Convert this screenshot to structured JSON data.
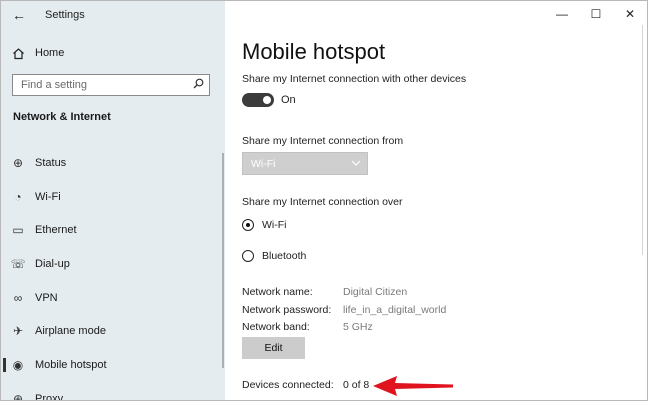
{
  "window": {
    "app_title": "Settings",
    "controls": {
      "minimize": "—",
      "maximize": "☐",
      "close": "✕"
    }
  },
  "sidebar": {
    "back_glyph": "←",
    "home_label": "Home",
    "search_placeholder": "Find a setting",
    "section_header": "Network & Internet",
    "items": [
      {
        "label": "Status",
        "icon": "status-icon",
        "glyph": "⊕"
      },
      {
        "label": "Wi-Fi",
        "icon": "wifi-icon",
        "glyph": "◔"
      },
      {
        "label": "Ethernet",
        "icon": "ethernet-icon",
        "glyph": "▭"
      },
      {
        "label": "Dial-up",
        "icon": "dialup-icon",
        "glyph": "☏"
      },
      {
        "label": "VPN",
        "icon": "vpn-icon",
        "glyph": "∞"
      },
      {
        "label": "Airplane mode",
        "icon": "airplane-icon",
        "glyph": "✈"
      },
      {
        "label": "Mobile hotspot",
        "icon": "hotspot-icon",
        "glyph": "◉",
        "active": true
      },
      {
        "label": "Proxy",
        "icon": "proxy-icon",
        "glyph": "⊕"
      }
    ]
  },
  "main": {
    "title": "Mobile hotspot",
    "share_label": "Share my Internet connection with other devices",
    "toggle": {
      "state": "On",
      "on": true
    },
    "share_from_label": "Share my Internet connection from",
    "share_from_value": "Wi-Fi",
    "share_over_label": "Share my Internet connection over",
    "share_over_options": [
      {
        "label": "Wi-Fi",
        "checked": true
      },
      {
        "label": "Bluetooth",
        "checked": false
      }
    ],
    "network": {
      "name_label": "Network name:",
      "name_value": "Digital Citizen",
      "password_label": "Network password:",
      "password_value": "life_in_a_digital_world",
      "band_label": "Network band:",
      "band_value": "5 GHz"
    },
    "edit_button": "Edit",
    "devices_label": "Devices connected:",
    "devices_value": "0 of 8"
  },
  "colors": {
    "sidebar_bg": "#e4ecef",
    "toggle_on": "#3c3c3c",
    "annotation_arrow": "#e0141e"
  }
}
